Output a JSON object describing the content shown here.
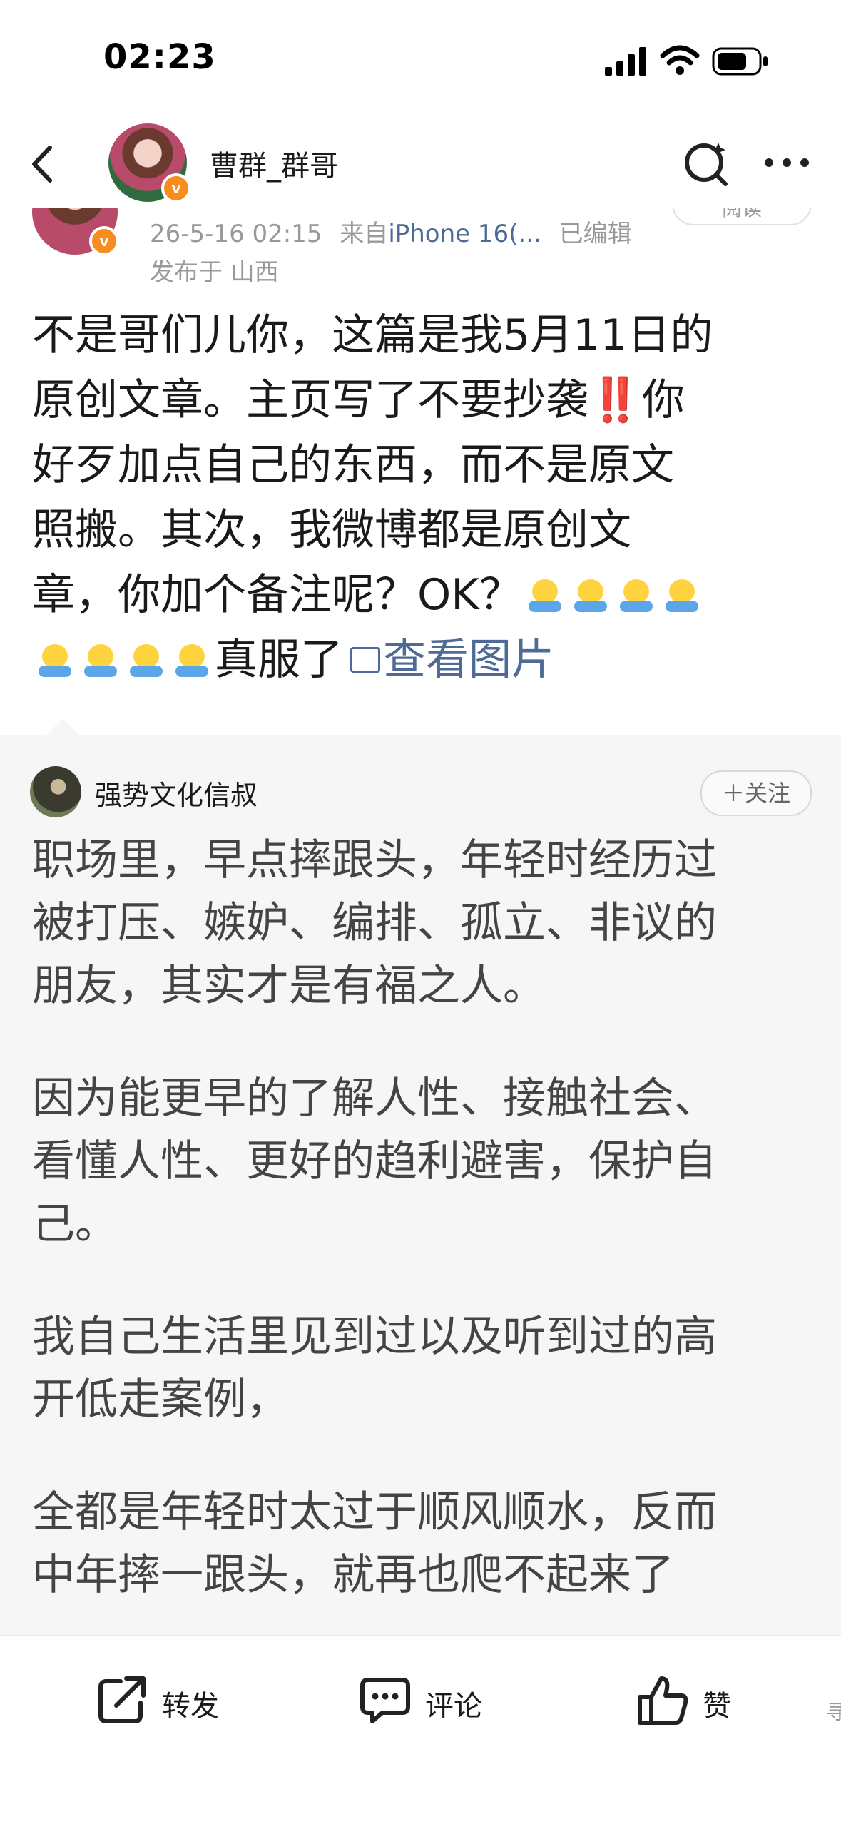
{
  "status_bar": {
    "time": "02:23"
  },
  "nav": {
    "name": "曹群_群哥"
  },
  "post": {
    "read_label": "阅读",
    "timestamp": "26-5-16 02:15",
    "source_prefix": "来自",
    "device": "iPhone 16(...",
    "edited": "已编辑",
    "location": "发布于 山西",
    "lines": [
      "不是哥们儿你，这篇是我5月11日的",
      "原创文章。主页写了不要抄袭",
      "你",
      "好歹加点自己的东西，而不是原文",
      "照搬。其次，我微博都是原创文",
      "章，你加个备注呢？OK？",
      "真服了"
    ],
    "double_bang": "‼️",
    "view_image_link": "查看图片"
  },
  "quoted": {
    "author": "强势文化信叔",
    "follow_label": "＋关注",
    "lines": [
      "职场里，早点摔跟头，年轻时经历过",
      "被打压、嫉妒、编排、孤立、非议的",
      "朋友，其实才是有福之人。",
      "因为能更早的了解人性、接触社会、",
      "看懂人性、更好的趋利避害，保护自",
      "己。",
      "我自己生活里见到过以及听到过的高",
      "开低走案例，",
      "全都是年轻时太过于顺风顺水，反而",
      "中年摔一跟头，就再也爬不起来了"
    ]
  },
  "actions": {
    "repost": "转发",
    "comment": "评论",
    "like": "赞"
  },
  "edge_glyph": "寻",
  "colors": {
    "link": "#4d6b96",
    "verified_badge": "#f78d1e",
    "quoted_bg": "#f6f6f6"
  }
}
